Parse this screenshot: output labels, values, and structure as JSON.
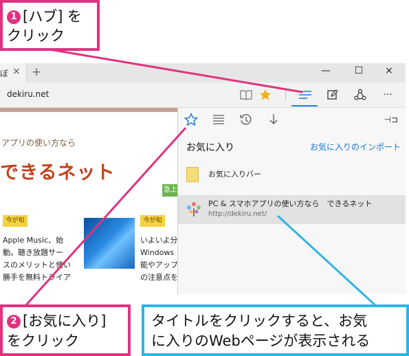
{
  "colors": {
    "callout_pink": "#e0327f",
    "callout_blue": "#2fb4e5",
    "accent": "#2b7bd4",
    "logo": "#c2411c"
  },
  "callouts": {
    "hub": {
      "number": "1",
      "line1": "[ハブ] を",
      "line2": "クリック"
    },
    "favorites": {
      "number": "2",
      "line1": "[お気に入り]",
      "line2": "をクリック"
    },
    "note": {
      "line1": "タイトルをクリックすると、お気",
      "line2": "に入りのWebページが表示される"
    }
  },
  "browser": {
    "tab": {
      "title": "ぼ",
      "close": "×"
    },
    "new_tab": "+",
    "window_buttons": {
      "minimize": "—",
      "maximize": "☐",
      "close": "×"
    },
    "address": "dekiru.net",
    "toolbar_icons": [
      "reading-view-icon",
      "favorite-star-icon",
      "hub-icon",
      "web-note-icon",
      "share-icon",
      "more-icon"
    ],
    "more": "···"
  },
  "page": {
    "tagline": "アプリの使い方なら",
    "logo": "できるネット",
    "tag1": "今が旬",
    "tag2": "今が旬",
    "col1": [
      "Apple Music、始",
      "動。聴き放題サー",
      "スのメリットと使い",
      "勝手を無料トライア"
    ],
    "col3": [
      "いよいよ分",
      "Windows",
      "能やアップ",
      "の注意点を"
    ],
    "badge": "急上"
  },
  "hub": {
    "tabs": [
      "favorites-icon",
      "reading-list-icon",
      "history-icon",
      "downloads-icon"
    ],
    "pin": "⊣⊐",
    "title": "お気に入り",
    "import_link": "お気に入りのインポート",
    "folder": "お気に入りバー",
    "site_title": "PC & スマホアプリの使い方なら　できるネット",
    "site_url": "http://dekiru.net/"
  }
}
